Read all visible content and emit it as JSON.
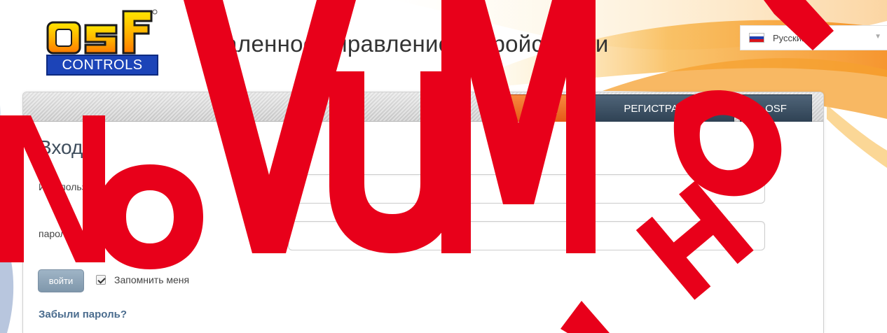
{
  "header": {
    "logo_text": "osf",
    "logo_subtext": "CONTROLS",
    "title": "Удаленное управление устройствами"
  },
  "language": {
    "selected": "Русский",
    "flag_icon": "flag-russia-icon"
  },
  "nav": {
    "tabs": [
      {
        "label": "ВХОД",
        "active": true
      },
      {
        "label": "РЕГИСТРАЦИЯ",
        "active": false
      },
      {
        "label": "OSF",
        "active": false
      }
    ]
  },
  "login": {
    "title": "Вход",
    "username_label": "Имя пользователя",
    "username_value": "",
    "password_label": "пароль",
    "password_value": "",
    "submit_label": "войти",
    "remember_label": "Запомнить меня",
    "remember_checked": true,
    "forgot_label": "Забыли пароль?"
  },
  "watermark": {
    "text": "NOVUM НОВ"
  },
  "colors": {
    "active_tab": "#ee6a22",
    "inactive_tab": "#3d5063",
    "link": "#4a6c8e",
    "watermark": "#e8001a"
  }
}
